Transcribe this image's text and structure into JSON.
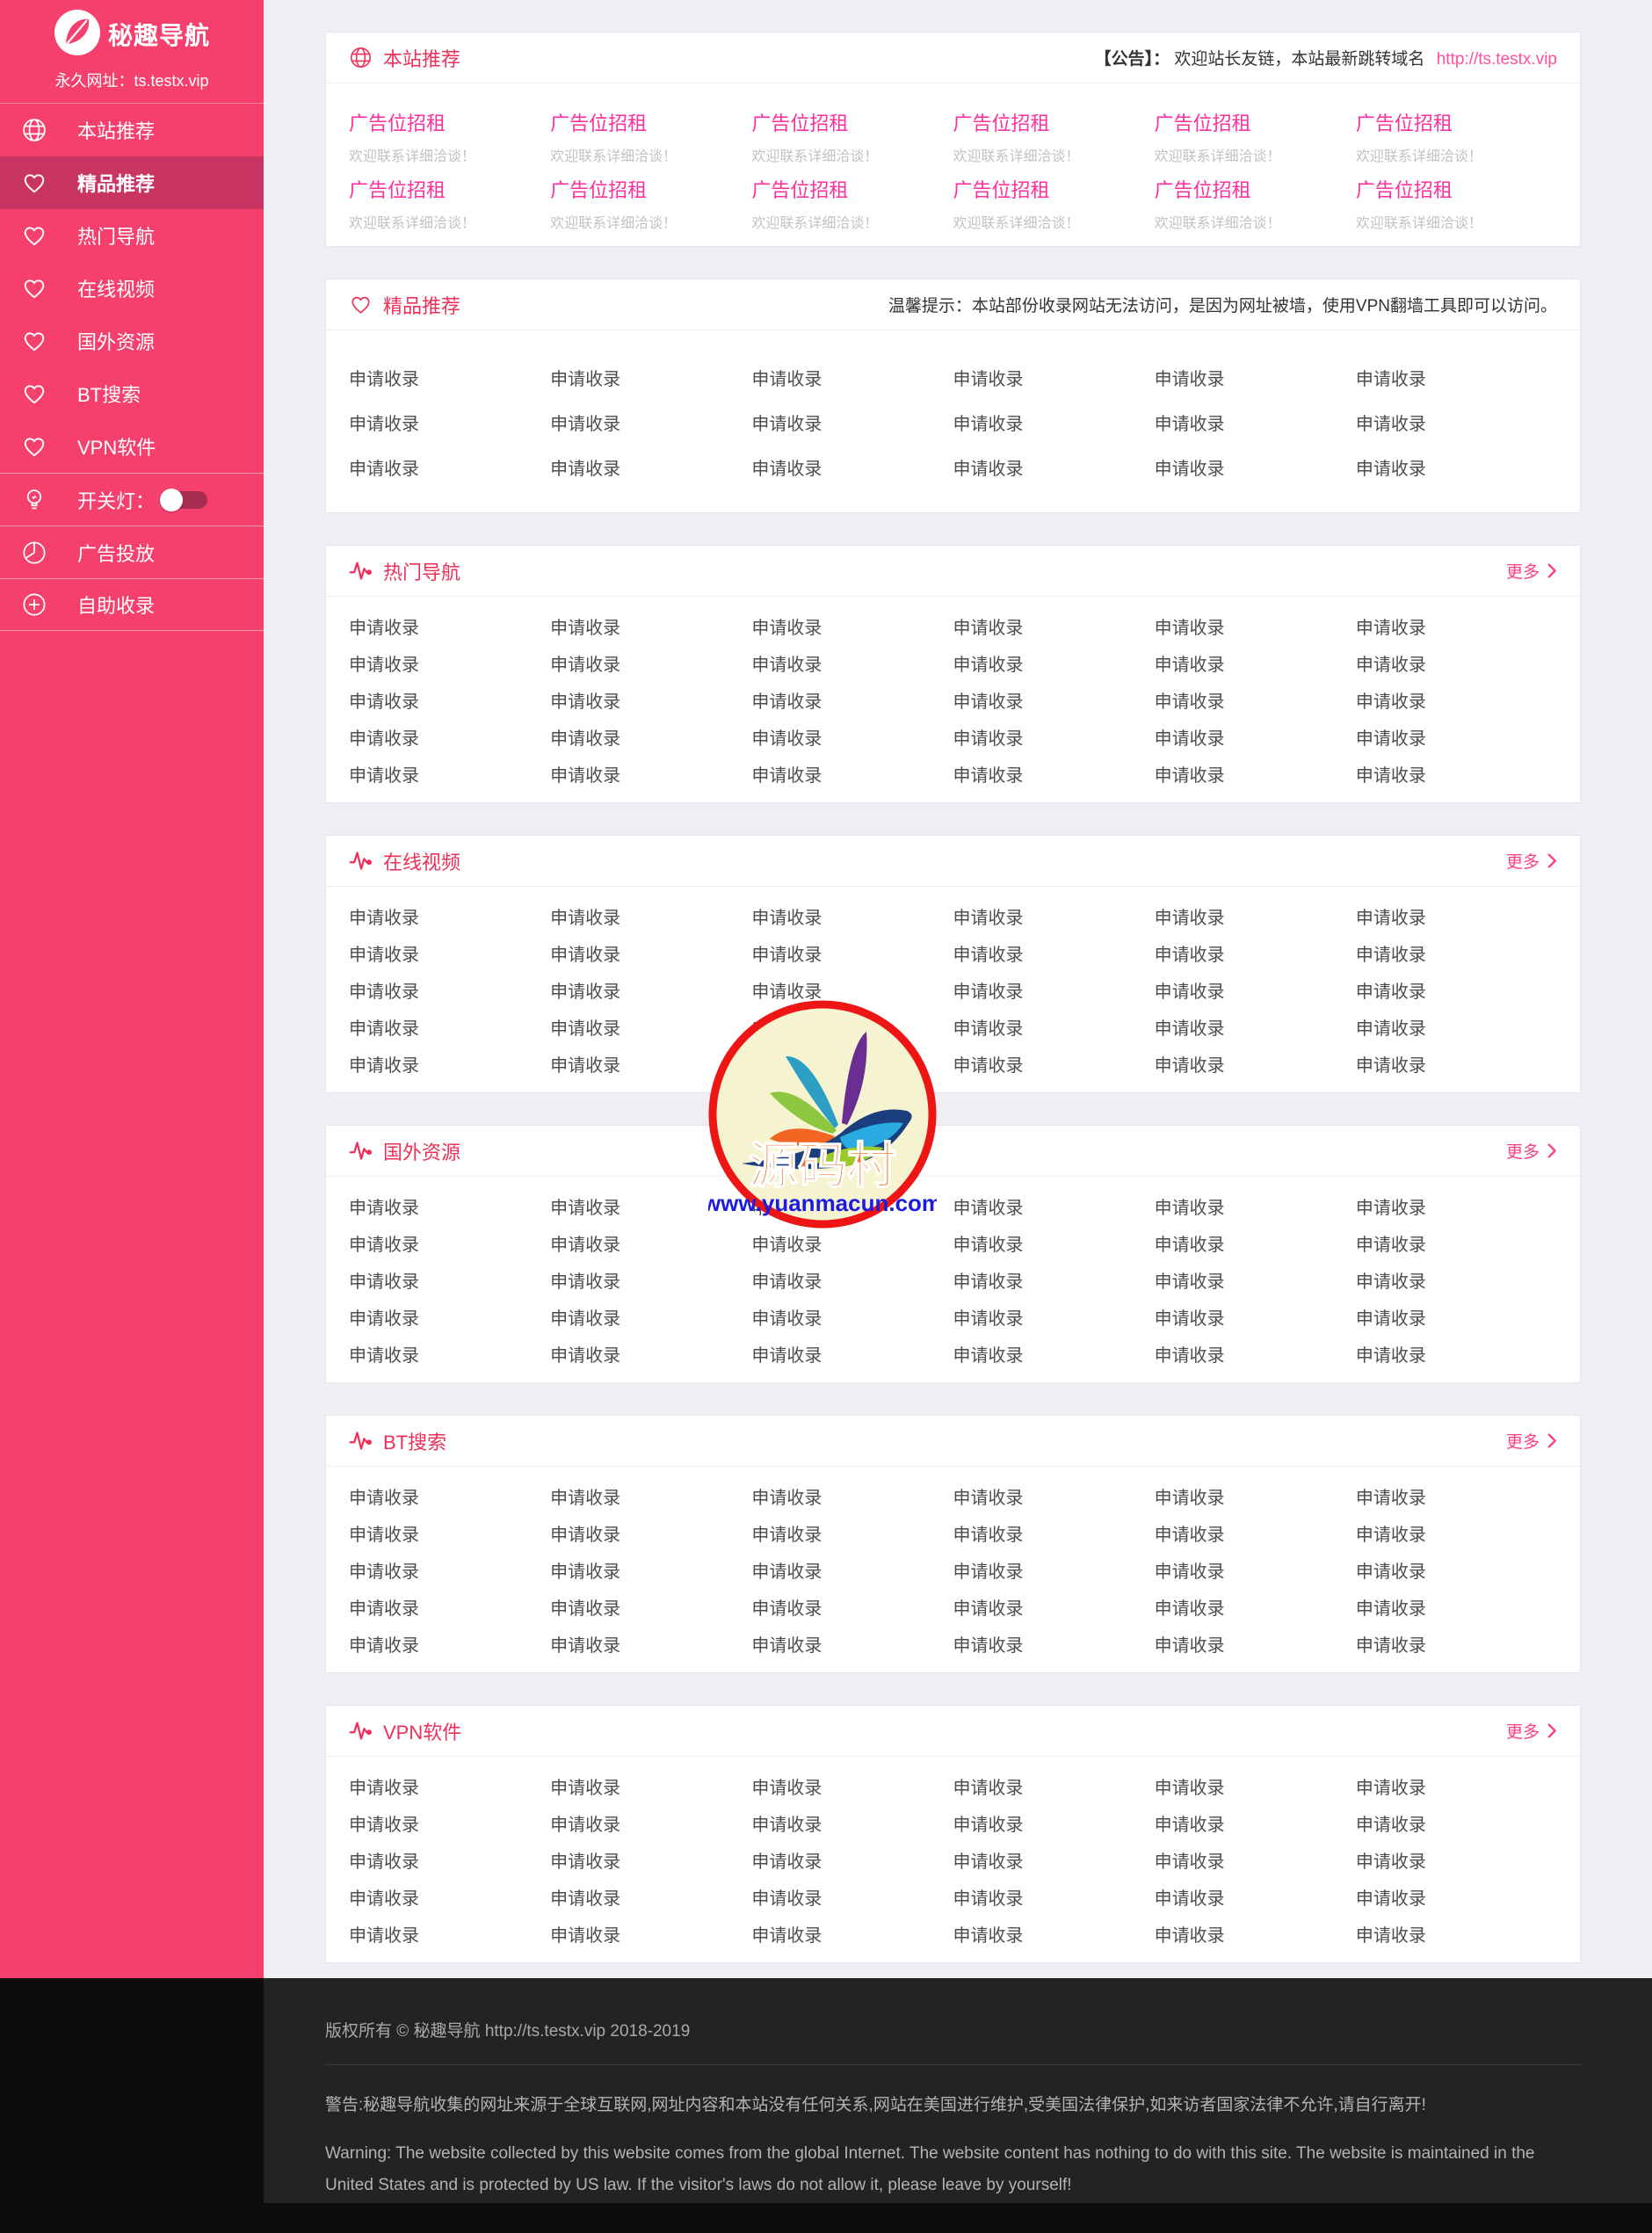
{
  "sidebar": {
    "logo_text": "秘趣导航",
    "tagline": "永久网址：ts.testx.vip",
    "menu": [
      {
        "label": "本站推荐",
        "icon": "globe-icon",
        "active": false
      },
      {
        "label": "精品推荐",
        "icon": "heart-icon",
        "active": true
      },
      {
        "label": "热门导航",
        "icon": "heart-icon",
        "active": false
      },
      {
        "label": "在线视频",
        "icon": "heart-icon",
        "active": false
      },
      {
        "label": "国外资源",
        "icon": "heart-icon",
        "active": false
      },
      {
        "label": "BT搜索",
        "icon": "heart-icon",
        "active": false
      },
      {
        "label": "VPN软件",
        "icon": "heart-icon",
        "active": false
      }
    ],
    "light_switch": {
      "label": "开关灯：",
      "state": "off"
    },
    "tools": [
      {
        "label": "广告投放",
        "icon": "pie-chart-icon"
      },
      {
        "label": "自助收录",
        "icon": "plus-circle-icon"
      }
    ]
  },
  "announcement": {
    "prefix": "【公告】：",
    "text": "欢迎站长友链，本站最新跳转域名",
    "link": "http://ts.testx.vip"
  },
  "tip": "温馨提示：本站部份收录网站无法访问，是因为网址被墙，使用VPN翻墙工具即可以访问。",
  "labels": {
    "apply": "申请收录",
    "ad_title": "广告位招租",
    "ad_subtitle": "欢迎联系详细洽谈！",
    "more": "更多"
  },
  "sections": [
    {
      "title": "本站推荐",
      "icon": "globe-icon",
      "type": "ads",
      "ad_rows": 2
    },
    {
      "title": "精品推荐",
      "icon": "heart-icon",
      "type": "items",
      "rows": 3
    },
    {
      "title": "热门导航",
      "icon": "pulse-icon",
      "type": "items",
      "rows": 5,
      "more": true
    },
    {
      "title": "在线视频",
      "icon": "pulse-icon",
      "type": "items",
      "rows": 5,
      "more": true
    },
    {
      "title": "国外资源",
      "icon": "pulse-icon",
      "type": "items",
      "rows": 5,
      "more": true
    },
    {
      "title": "BT搜索",
      "icon": "pulse-icon",
      "type": "items",
      "rows": 5,
      "more": true
    },
    {
      "title": "VPN软件",
      "icon": "pulse-icon",
      "type": "items",
      "rows": 5,
      "more": true
    }
  ],
  "watermark": {
    "name": "源码村",
    "site": "www.yuanmacun.com"
  },
  "footer": {
    "copyright": "版权所有 © 秘趣导航 http://ts.testx.vip 2018-2019",
    "warning_zh": "警告:秘趣导航收集的网址来源于全球互联网,网址内容和本站没有任何关系,网站在美国进行维护,受美国法律保护,如来访者国家法律不允许,请自行离开!",
    "warning_en_line1": "Warning: The website collected by this website comes from the global Internet. The website content has nothing to do with this site. The website is maintained in the",
    "warning_en_line2": "United States and is protected by US law. If the visitor's laws do not allow it, please leave by yourself!"
  },
  "colors": {
    "sidebar": "#f5406e",
    "sidebar_active": "#c93563",
    "section_title": "#ee3059",
    "ad_text": "#ff2f9d",
    "announcement_link": "#ff4f9e",
    "more_link": "#ff3d84",
    "page_bg": "#eeeef3",
    "footer_bg": "#232323"
  }
}
